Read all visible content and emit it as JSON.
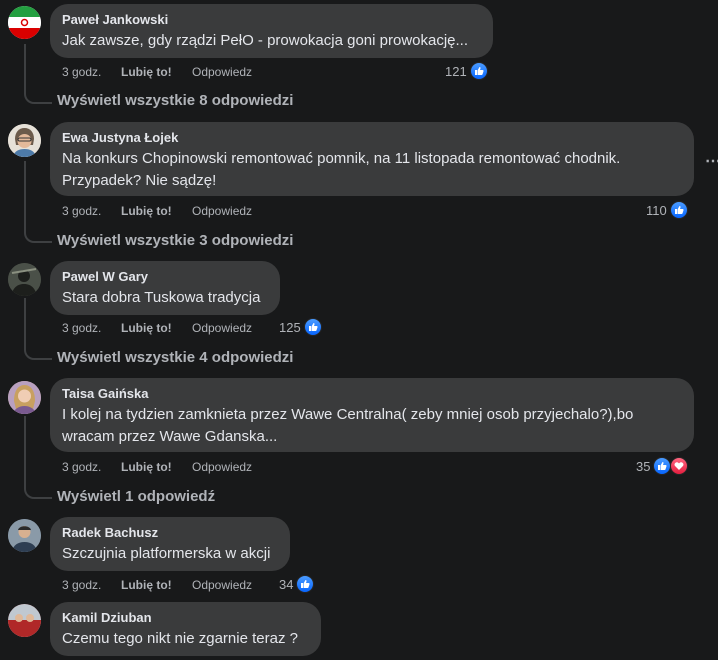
{
  "comments": [
    {
      "author": "Paweł Jankowski",
      "text": "Jak zawsze, gdy rządzi PełO - prowokacja goni prowokację...",
      "time": "3 godz.",
      "like": "Lubię to!",
      "reply": "Odpowiedz",
      "reactions": "121",
      "view_replies": "Wyświetl wszystkie 8 odpowiedzi"
    },
    {
      "author": "Ewa Justyna Łojek",
      "text_line1": "Na konkurs Chopinowski remontować pomnik, na 11 listopada remontować chodnik.",
      "text_line2": "Przypadek? Nie sądzę!",
      "time": "3 godz.",
      "like": "Lubię to!",
      "reply": "Odpowiedz",
      "reactions": "110",
      "view_replies": "Wyświetl wszystkie 3 odpowiedzi"
    },
    {
      "author": "Pawel W Gary",
      "text": "Stara dobra Tuskowa tradycja",
      "time": "3 godz.",
      "like": "Lubię to!",
      "reply": "Odpowiedz",
      "reactions": "125",
      "view_replies": "Wyświetl wszystkie 4 odpowiedzi"
    },
    {
      "author": "Taisa Gaińska",
      "text_line1": "I kolej na tydzien zamknieta przez Wawe Centralna( zeby mniej osob przyjechalo?),bo",
      "text_line2": "wracam przez Wawe Gdanska...",
      "time": "3 godz.",
      "like": "Lubię to!",
      "reply": "Odpowiedz",
      "reactions": "35",
      "view_replies": "Wyświetl 1 odpowiedź"
    },
    {
      "author": "Radek Bachusz",
      "text": "Szczujnia platformerska w akcji",
      "time": "3 godz.",
      "like": "Lubię to!",
      "reply": "Odpowiedz",
      "reactions": "34"
    },
    {
      "author": "Kamil Dziuban",
      "text": "Czemu tego nikt nie zgarnie teraz ?"
    }
  ],
  "icons": {
    "like": "thumbs-up-icon",
    "love": "heart-icon",
    "more": "more-options-icon"
  },
  "colors": {
    "background": "#18191a",
    "bubble": "#3a3b3c",
    "like_blue": "#0866ff",
    "love_red": "#e41e3f",
    "secondary_text": "#b0b3b8"
  }
}
